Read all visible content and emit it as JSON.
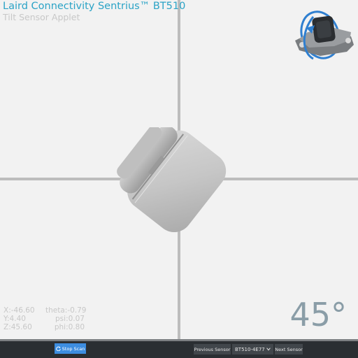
{
  "header": {
    "title": "Laird Connectivity Sentrius™ BT510",
    "subtitle": "Tilt Sensor Applet"
  },
  "readouts": {
    "x": "X:-46.60",
    "y": "Y:4.40",
    "z": "Z:45.60",
    "theta": "theta:-0.79",
    "psi": "psi:0.07",
    "phi": "phi:0.80"
  },
  "angle": "45°",
  "toolbar": {
    "stop_scan_label": "Stop Scan",
    "stop_scan_icon": "refresh-icon",
    "previous_sensor_label": "Previous Sensor",
    "sensor_select_value": "BT510-4E77",
    "next_sensor_label": "Next Sensor"
  },
  "colors": {
    "title": "#2ba3c6",
    "accent_button": "#3d8de0",
    "bar": "#2a2e32",
    "angle": "#8a9da7"
  }
}
